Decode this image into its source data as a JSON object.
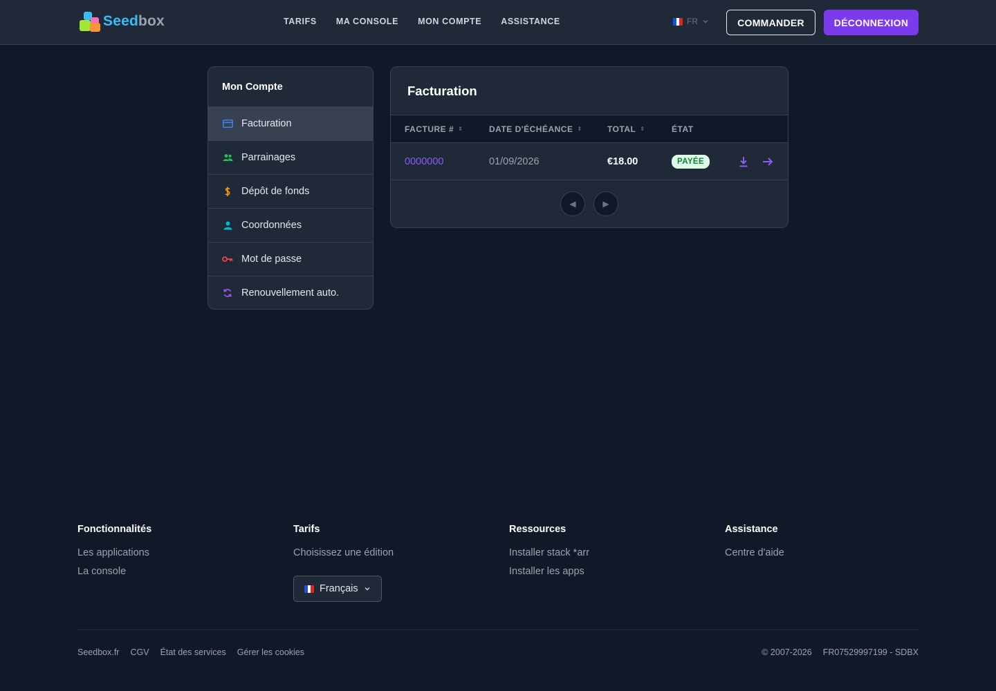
{
  "header": {
    "logo": {
      "part1": "Seed",
      "part2": "box"
    },
    "nav": [
      "TARIFS",
      "MA CONSOLE",
      "MON COMPTE",
      "ASSISTANCE"
    ],
    "language": "FR",
    "order_label": "COMMANDER",
    "logout_label": "DÉCONNEXION"
  },
  "sidebar": {
    "title": "Mon Compte",
    "items": [
      {
        "label": "Facturation",
        "icon": "credit-card-icon",
        "color": "#3b82f6",
        "active": true
      },
      {
        "label": "Parrainages",
        "icon": "users-icon",
        "color": "#22c55e"
      },
      {
        "label": "Dépôt de fonds",
        "icon": "dollar-icon",
        "color": "#f59e0b"
      },
      {
        "label": "Coordonnées",
        "icon": "user-icon",
        "color": "#06b6d4"
      },
      {
        "label": "Mot de passe",
        "icon": "key-icon",
        "color": "#ef4444"
      },
      {
        "label": "Renouvellement auto.",
        "icon": "refresh-icon",
        "color": "#a855f7"
      }
    ]
  },
  "billing": {
    "title": "Facturation",
    "columns": [
      "FACTURE #",
      "DATE D'ÉCHÉANCE",
      "TOTAL",
      "ÉTAT"
    ],
    "rows": [
      {
        "invoice": "0000000",
        "due_date": "01/09/2026",
        "total": "€18.00",
        "status": "PAYÉE"
      }
    ]
  },
  "footer": {
    "columns": [
      {
        "title": "Fonctionnalités",
        "links": [
          "Les applications",
          "La console"
        ]
      },
      {
        "title": "Tarifs",
        "links": [
          "Choisissez une édition"
        ]
      },
      {
        "title": "Ressources",
        "links": [
          "Installer stack *arr",
          "Installer les apps"
        ]
      },
      {
        "title": "Assistance",
        "links": [
          "Centre d'aide"
        ]
      }
    ],
    "language_select": "Français",
    "bottom_links": [
      "Seedbox.fr",
      "CGV",
      "État des services",
      "Gérer les cookies"
    ],
    "copyright": "© 2007-2026",
    "company_id": "FR07529997199 - SDBX"
  },
  "colors": {
    "accent": "#7c3aed",
    "link": "#8b5cf6",
    "paid_bg": "#dcfce7",
    "paid_text": "#15803d"
  }
}
